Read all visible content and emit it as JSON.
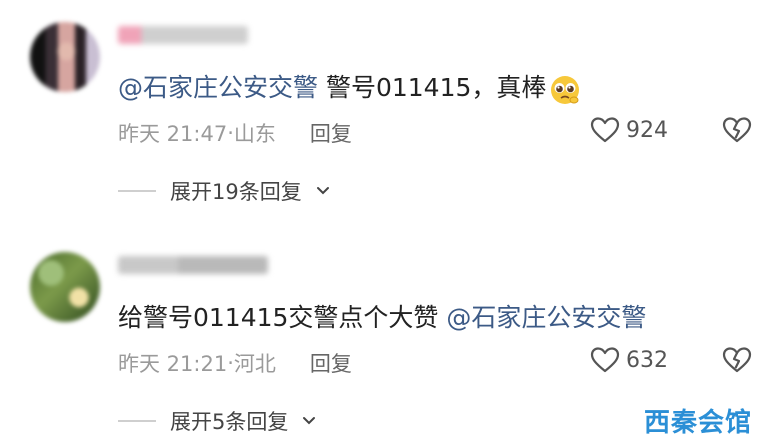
{
  "comments": [
    {
      "mention": "@石家庄公安交警",
      "text_after": " 警号011415，真棒",
      "time": "昨天 21:47",
      "location": "山东",
      "reply_label": "回复",
      "likes": "924",
      "expand_label": "展开19条回复",
      "expand_icon": "chevron-down-icon"
    },
    {
      "text_before": "给警号011415交警点个大赞 ",
      "mention": "@石家庄公安交警",
      "time": "昨天 21:21",
      "location": "河北",
      "reply_label": "回复",
      "likes": "632",
      "expand_label": "展开5条回复",
      "expand_icon": "chevron-down-icon"
    }
  ],
  "separator": "·",
  "watermark": "西秦会馆",
  "colors": {
    "mention": "#3c5a86",
    "meta": "#9a9a9a",
    "watermark": "#2b8fd6"
  }
}
